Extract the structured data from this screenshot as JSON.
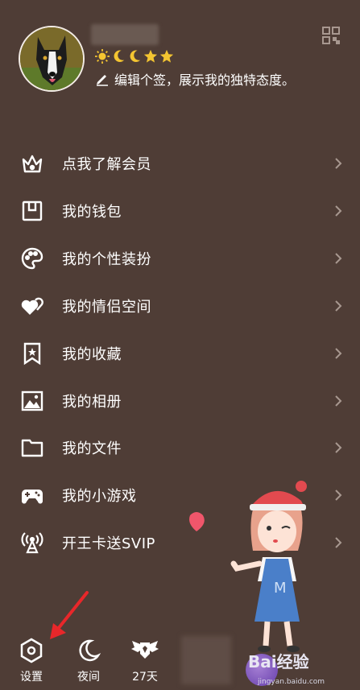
{
  "profile": {
    "signature": "编辑个签，展示我的独特态度。",
    "level_badges": [
      "sun-icon",
      "moon-icon",
      "moon-icon",
      "star-icon",
      "star-icon"
    ]
  },
  "menu": [
    {
      "icon": "crown-icon",
      "label": "点我了解会员"
    },
    {
      "icon": "wallet-icon",
      "label": "我的钱包"
    },
    {
      "icon": "palette-icon",
      "label": "我的个性装扮"
    },
    {
      "icon": "hearts-icon",
      "label": "我的情侣空间"
    },
    {
      "icon": "bookmark-star-icon",
      "label": "我的收藏"
    },
    {
      "icon": "photo-icon",
      "label": "我的相册"
    },
    {
      "icon": "folder-icon",
      "label": "我的文件"
    },
    {
      "icon": "gamepad-icon",
      "label": "我的小游戏"
    },
    {
      "icon": "broadcast-icon",
      "label": "开王卡送SVIP"
    }
  ],
  "bottom_bar": {
    "settings": "设置",
    "night": "夜间",
    "days": "27天"
  },
  "watermark": {
    "brand": "Bai经验",
    "url": "jingyan.baidu.com"
  },
  "colors": {
    "background": "#4f3d36",
    "text": "#ffffff",
    "annotation_arrow": "#e8272a",
    "badge_gold": "#f4c531"
  }
}
